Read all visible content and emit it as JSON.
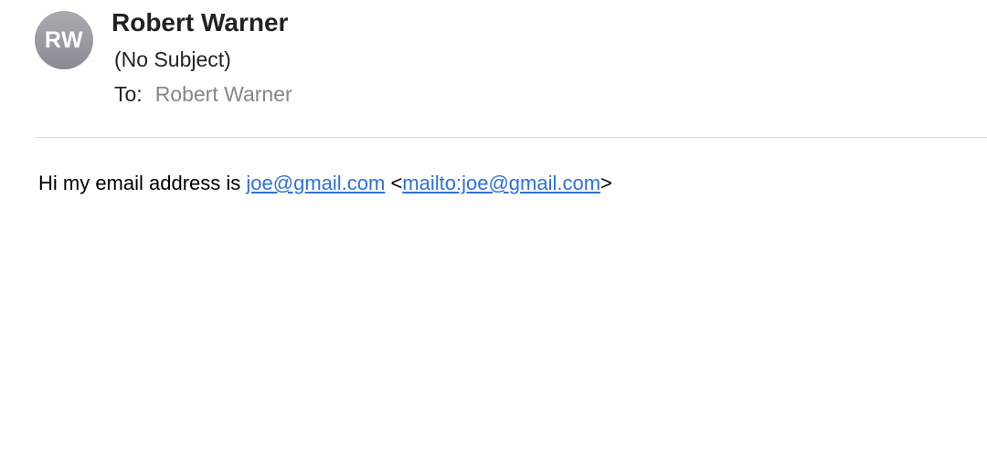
{
  "message": {
    "avatar_initials": "RW",
    "sender_name": "Robert Warner",
    "subject": "(No Subject)",
    "to_label": "To:",
    "to_value": "Robert Warner",
    "body": {
      "intro_text": "Hi my email address is ",
      "email_link": "joe@gmail.com",
      "open_bracket": " <",
      "mailto_link": "mailto:joe@gmail.com",
      "close_bracket": ">"
    }
  },
  "colors": {
    "avatar_bg": "#8a8c93",
    "link": "#2f6fd6",
    "secondary_text": "#86868b",
    "divider": "#dcdcdc"
  }
}
